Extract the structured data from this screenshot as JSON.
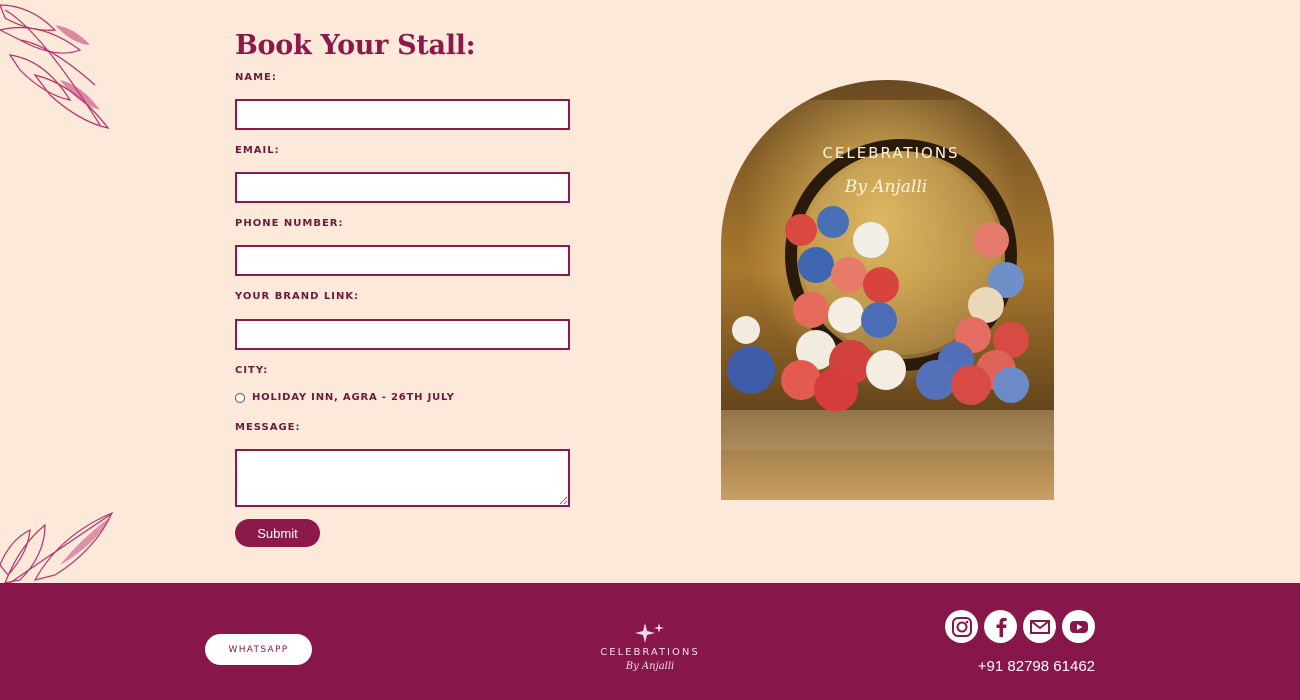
{
  "form": {
    "title": "Book Your Stall:",
    "name_label": "NAME:",
    "email_label": "EMAIL:",
    "phone_label": "PHONE NUMBER:",
    "brand_label": "YOUR BRAND LINK:",
    "city_label": "CITY:",
    "city_option": "HOLIDAY INN, AGRA - 26TH JULY",
    "message_label": "MESSAGE:",
    "submit_label": "Submit"
  },
  "image": {
    "sign_word": "CELEBRATIONS",
    "sign_script": "By Anjalli"
  },
  "footer": {
    "whatsapp_label": "WHATSAPP",
    "logo_word": "CELEBRATIONS",
    "logo_script": "By Anjalli",
    "phone": "+91 82798 61462",
    "social": [
      "instagram-icon",
      "facebook-icon",
      "email-icon",
      "youtube-icon"
    ]
  },
  "colors": {
    "background": "#fde9da",
    "brand": "#87174a",
    "label": "#6b1a3d"
  }
}
